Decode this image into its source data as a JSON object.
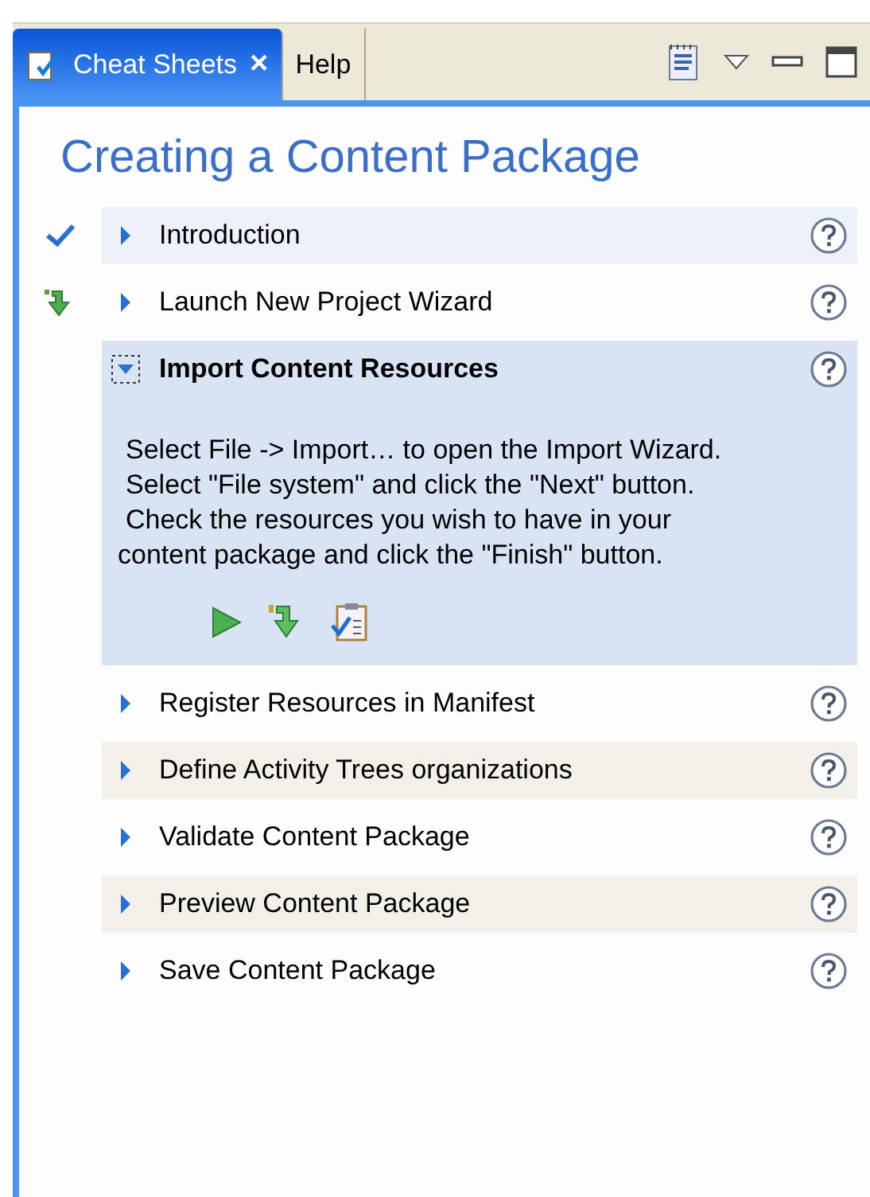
{
  "tabs": [
    {
      "label": "Cheat Sheets",
      "close": "×",
      "selected": true
    },
    {
      "label": "Help",
      "selected": false
    }
  ],
  "title": "Creating a Content Package",
  "steps": [
    {
      "label": "Introduction",
      "complete": true,
      "current": false,
      "expanded": false,
      "shaded": false
    },
    {
      "label": "Launch New Project Wizard",
      "complete": false,
      "current": true,
      "expanded": false,
      "shaded": false
    },
    {
      "label": "Import Content Resources",
      "complete": false,
      "current": false,
      "expanded": true,
      "shaded": false,
      "description": [
        "Select File -> Import… to open the Import Wizard.",
        "Select \"File system\" and click the \"Next\" button.",
        "Check the resources you wish to have in your content package and click the \"Finish\" button."
      ]
    },
    {
      "label": "Register Resources in Manifest",
      "complete": false,
      "current": false,
      "expanded": false,
      "shaded": false
    },
    {
      "label": "Define Activity Trees organizations",
      "complete": false,
      "current": false,
      "expanded": false,
      "shaded": true
    },
    {
      "label": "Validate Content Package",
      "complete": false,
      "current": false,
      "expanded": false,
      "shaded": false
    },
    {
      "label": "Preview Content Package",
      "complete": false,
      "current": false,
      "expanded": false,
      "shaded": true
    },
    {
      "label": "Save Content Package",
      "complete": false,
      "current": false,
      "expanded": false,
      "shaded": false
    }
  ]
}
